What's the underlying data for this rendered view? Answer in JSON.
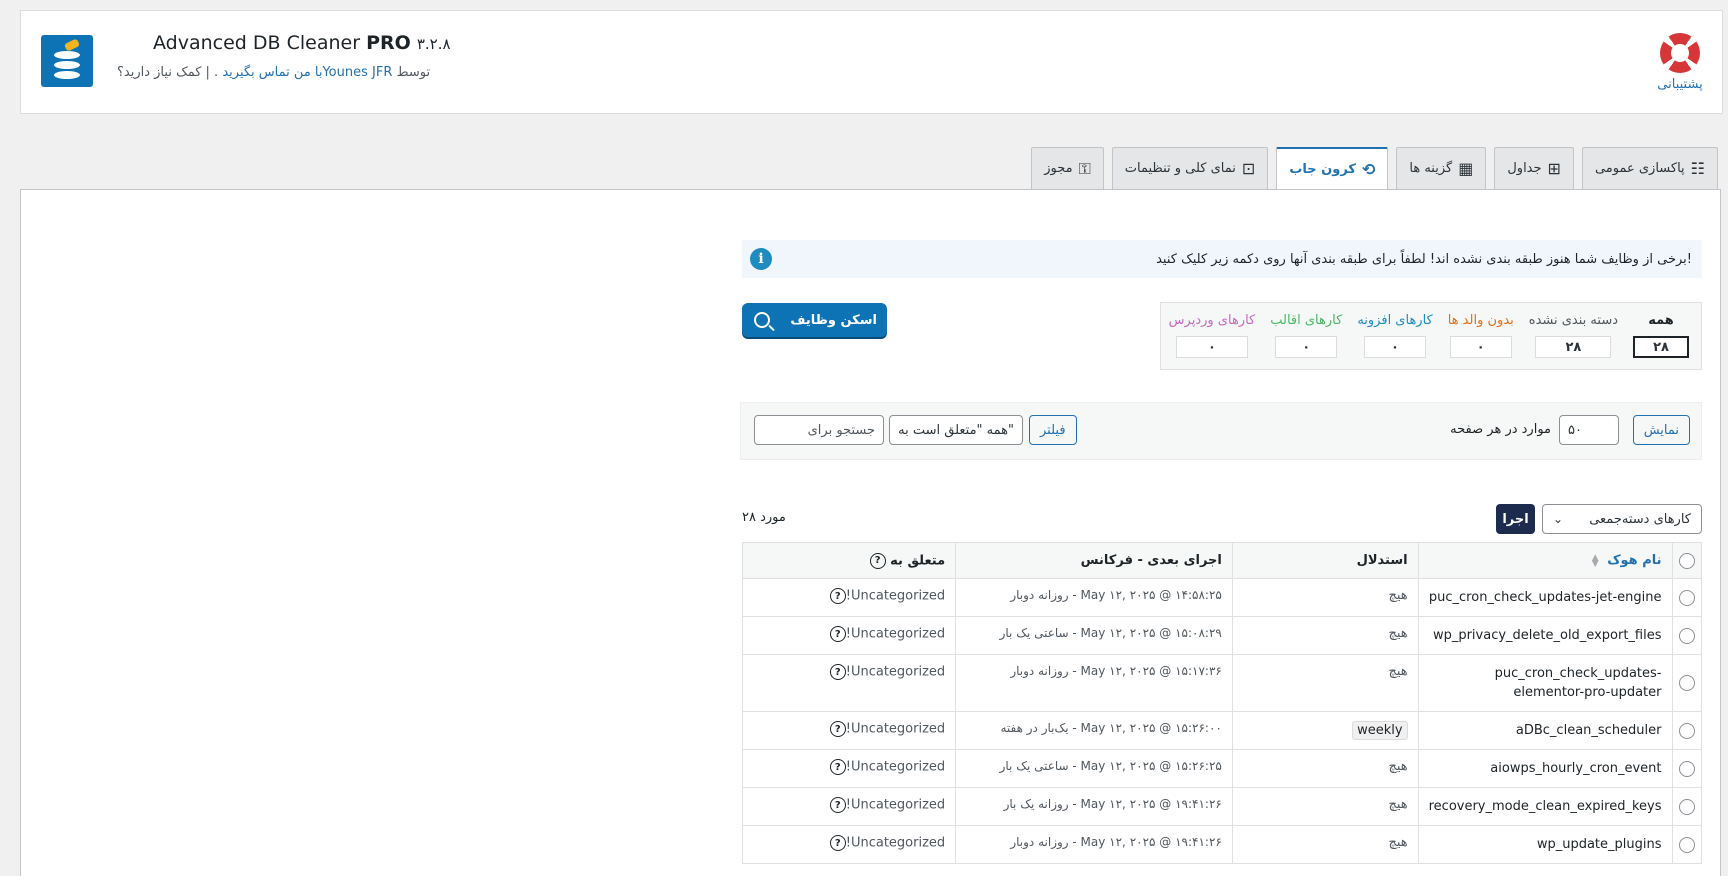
{
  "header": {
    "title": "Advanced DB Cleaner",
    "title_pro": "PRO",
    "version": "۳.۲.۸",
    "by_prefix": "توسط",
    "author": "Younes JFR",
    "help_text": ". | کمک نیاز دارید؟",
    "contact_link": "با من تماس بگیرید",
    "support_label": "پشتیبانی",
    "support_icon": "lifebuoy-icon"
  },
  "tabs": [
    {
      "label": "پاکسازی عمومی",
      "icon": "list-icon",
      "glyph": "☷",
      "active": false
    },
    {
      "label": "جداول",
      "icon": "grid-icon",
      "glyph": "⊞",
      "active": false
    },
    {
      "label": "گزینه ها",
      "icon": "options-icon",
      "glyph": "▦",
      "active": false
    },
    {
      "label": "کرون جاب",
      "icon": "history-clock-icon",
      "glyph": "⟲",
      "active": true
    },
    {
      "label": "نمای کلی و تنظیمات",
      "icon": "overview-icon",
      "glyph": "⊡",
      "active": false
    },
    {
      "label": "مجوز",
      "icon": "key-icon",
      "glyph": "⚿",
      "active": false
    }
  ],
  "notice": {
    "text": "برخی از وظایف شما هنوز طبقه بندی نشده اند! لطفاً برای طبقه بندی آنها روی دکمه زیر کلیک کنید!",
    "icon": "info-icon"
  },
  "stats": [
    {
      "label": "همه",
      "value": "۲۸",
      "color": "#1d2327",
      "bold": true
    },
    {
      "label": "دسته بندی نشده",
      "value": "۲۸",
      "color": "#50575e",
      "bold": false
    },
    {
      "label": "بدون والد ها",
      "value": "۰",
      "color": "#e26f1b",
      "bold": false
    },
    {
      "label": "کارهای افزونه",
      "value": "۰",
      "color": "#1e8cbe",
      "bold": false
    },
    {
      "label": "کارهای اقالب",
      "value": "۰",
      "color": "#4ab866",
      "bold": false
    },
    {
      "label": "کارهای وردپرس",
      "value": "۰",
      "color": "#c76ac2",
      "bold": false
    }
  ],
  "scan_button": {
    "label": "اسکن وظایف",
    "icon": "search-icon"
  },
  "filters": {
    "show_label": "نمایش",
    "per_page_value": "۵۰",
    "per_page_label": "موارد در هر صفحه",
    "filter_label": "فیلتر",
    "belongs_select": "همه \"متعلق است به\"",
    "search_placeholder": "جستجو برای"
  },
  "bulk": {
    "select_label": "کارهای دسته‌جمعی",
    "apply_label": "اجرا",
    "count_text": "۲۸ مورد"
  },
  "table": {
    "headers": {
      "hook": "نام هوک",
      "args": "استدلال",
      "next": "اجرای بعدی - فرکانس",
      "belongs": "متعلق به"
    },
    "rows": [
      {
        "hook": "puc_cron_check_updates-jet-engine",
        "args": "هیچ",
        "next": "May ۱۲, ۲۰۲۵ @ ۱۴:۵۸:۲۵ - روزانه دوبار",
        "belongs": "Uncategorized!"
      },
      {
        "hook": "wp_privacy_delete_old_export_files",
        "args": "هیچ",
        "next": "May ۱۲, ۲۰۲۵ @ ۱۵:۰۸:۲۹ - ساعتی یک بار",
        "belongs": "Uncategorized!"
      },
      {
        "hook": "puc_cron_check_updates-elementor-pro-updater",
        "args": "هیچ",
        "next": "May ۱۲, ۲۰۲۵ @ ۱۵:۱۷:۳۶ - روزانه دوبار",
        "belongs": "Uncategorized!"
      },
      {
        "hook": "aDBc_clean_scheduler",
        "args": "weekly",
        "next": "May ۱۲, ۲۰۲۵ @ ۱۵:۲۶:۰۰ - یک‌بار در هفته",
        "belongs": "Uncategorized!"
      },
      {
        "hook": "aiowps_hourly_cron_event",
        "args": "هیچ",
        "next": "May ۱۲, ۲۰۲۵ @ ۱۵:۲۶:۲۵ - ساعتی یک بار",
        "belongs": "Uncategorized!"
      },
      {
        "hook": "recovery_mode_clean_expired_keys",
        "args": "هیچ",
        "next": "May ۱۲, ۲۰۲۵ @ ۱۹:۴۱:۲۶ - روزانه یک بار",
        "belongs": "Uncategorized!"
      },
      {
        "hook": "wp_update_plugins",
        "args": "هیچ",
        "next": "May ۱۲, ۲۰۲۵ @ ۱۹:۴۱:۲۶ - روزانه دوبار",
        "belongs": "Uncategorized!"
      }
    ]
  }
}
